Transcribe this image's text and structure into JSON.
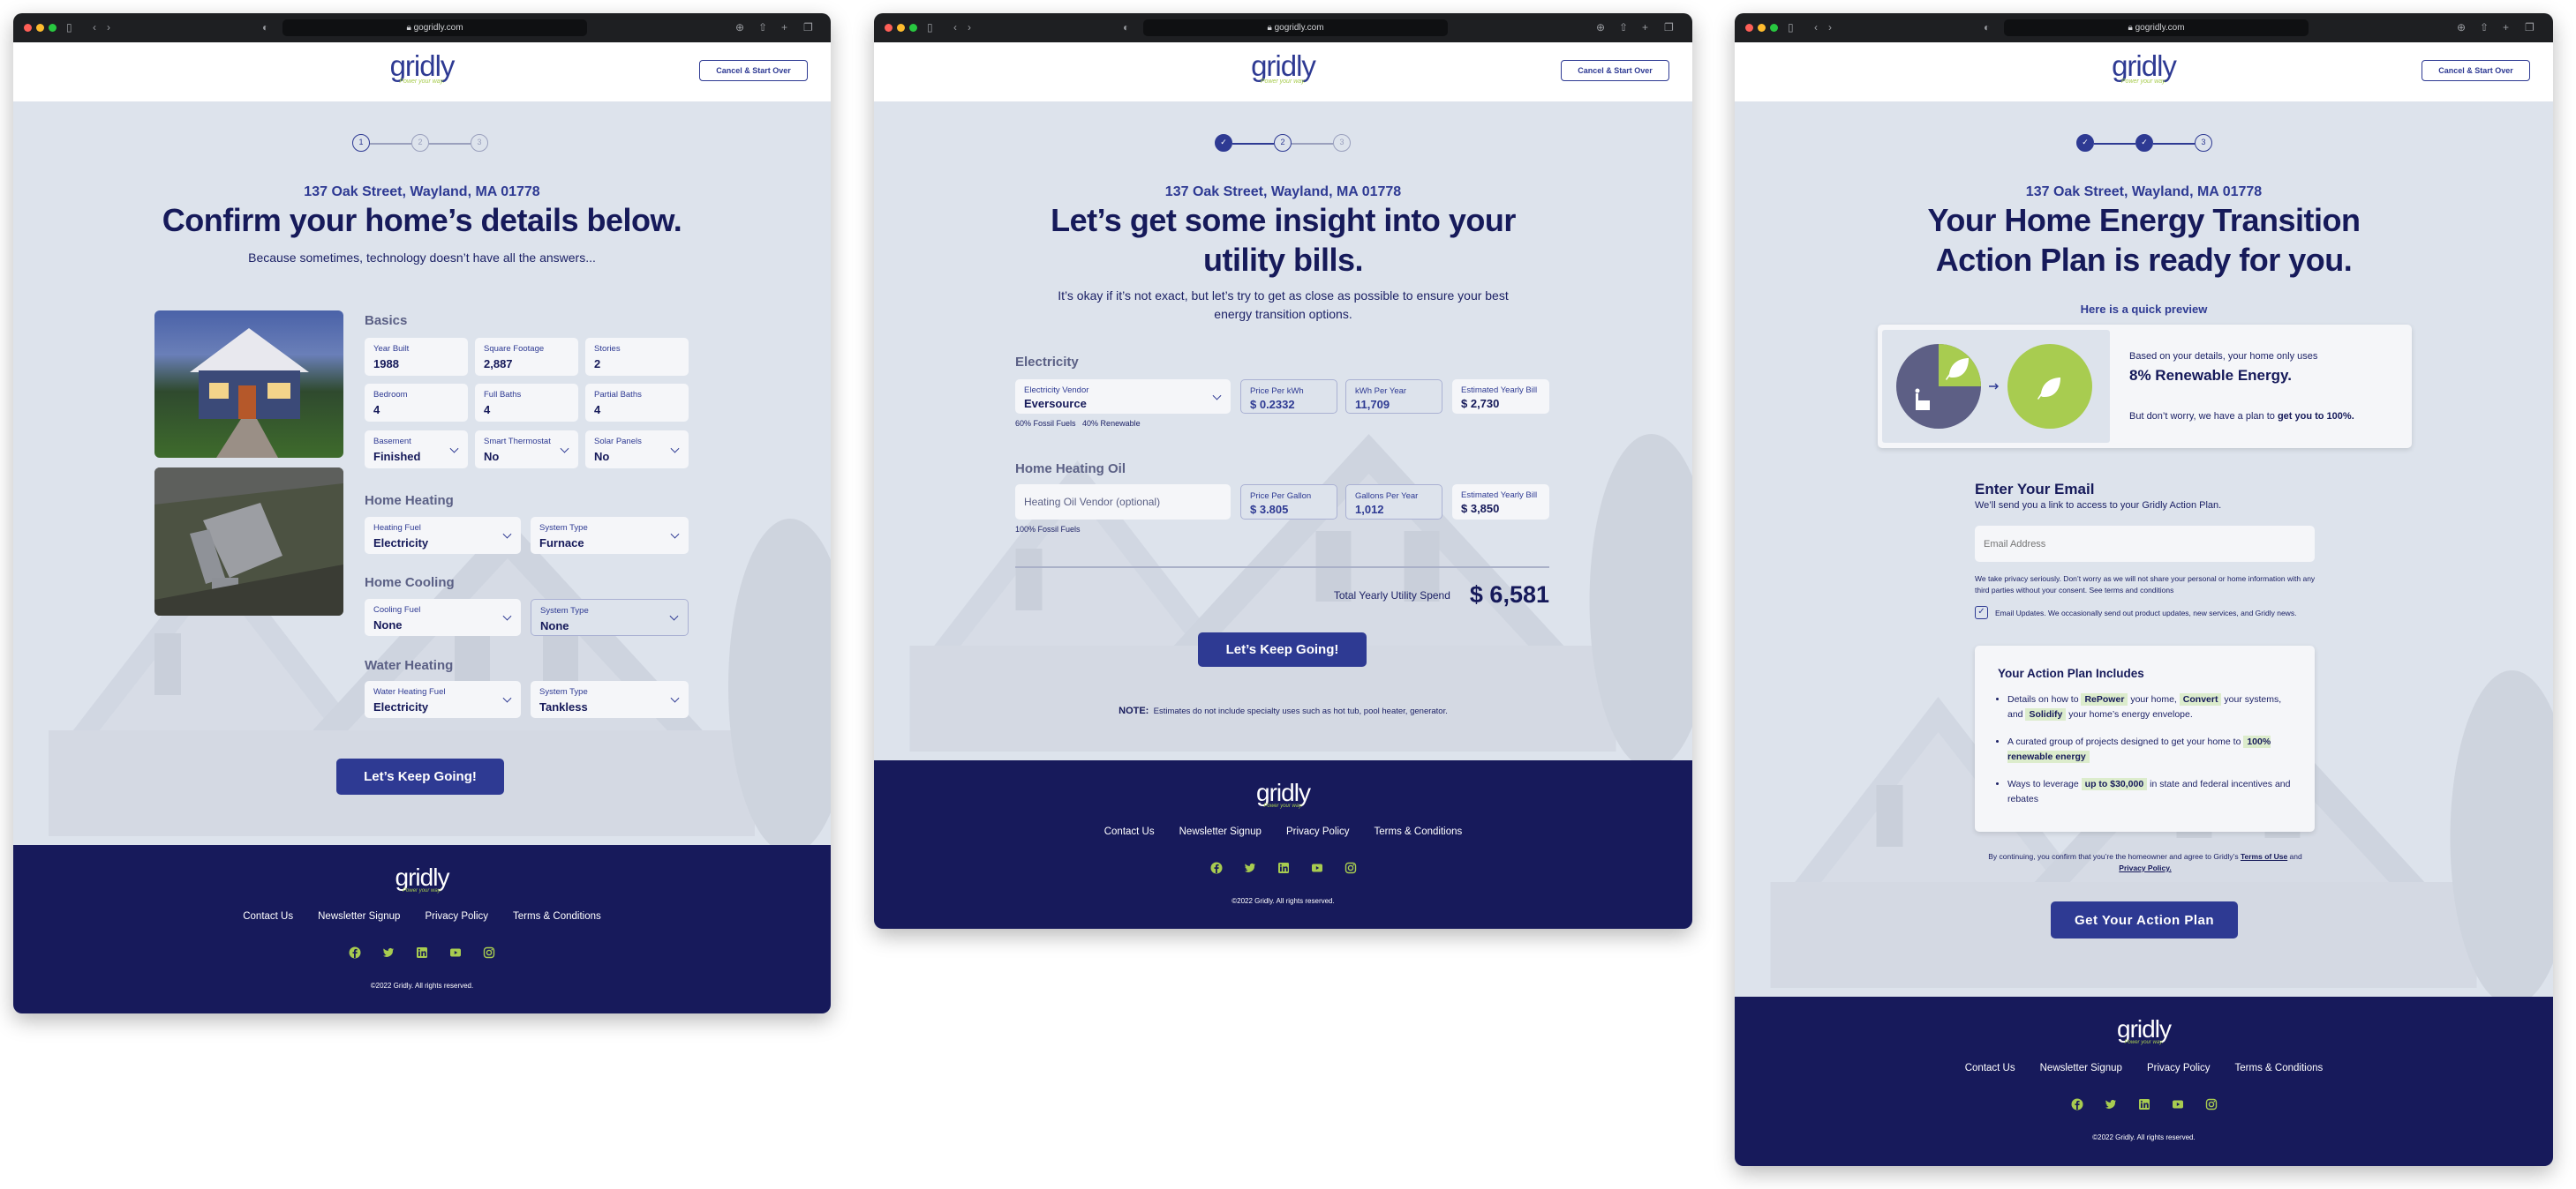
{
  "browser": {
    "url": "gogridly.com"
  },
  "brand": {
    "logo": "gridly",
    "tagline": "Power your way."
  },
  "header": {
    "cancel_label": "Cancel & Start Over"
  },
  "address": "137 Oak Street, Wayland, MA 01778",
  "colors": {
    "navy": "#161a5a",
    "primary": "#2e3a93",
    "accent_green": "#a8cc50",
    "background": "#dde3ec",
    "footer": "#171a5b"
  },
  "footer": {
    "links": [
      "Contact Us",
      "Newsletter Signup",
      "Privacy Policy",
      "Terms & Conditions"
    ],
    "social": [
      "facebook-icon",
      "twitter-icon",
      "linkedin-icon",
      "youtube-icon",
      "instagram-icon"
    ],
    "copyright": "©2022 Gridly. All rights reserved."
  },
  "step1": {
    "steps": [
      "1",
      "2",
      "3"
    ],
    "title": "Confirm your home’s details below.",
    "subtitle": "Because sometimes, technology doesn’t have all the answers...",
    "basics": {
      "heading": "Basics",
      "fields": [
        {
          "label": "Year Built",
          "value": "1988"
        },
        {
          "label": "Square Footage",
          "value": "2,887"
        },
        {
          "label": "Stories",
          "value": "2"
        },
        {
          "label": "Bedroom",
          "value": "4"
        },
        {
          "label": "Full Baths",
          "value": "4"
        },
        {
          "label": "Partial Baths",
          "value": "4"
        },
        {
          "label": "Basement",
          "value": "Finished"
        },
        {
          "label": "Smart Thermostat",
          "value": "No"
        },
        {
          "label": "Solar Panels",
          "value": "No"
        }
      ]
    },
    "heating": {
      "heading": "Home Heating",
      "fuel": {
        "label": "Heating Fuel",
        "value": "Electricity"
      },
      "system": {
        "label": "System Type",
        "value": "Furnace"
      }
    },
    "cooling": {
      "heading": "Home Cooling",
      "fuel": {
        "label": "Cooling Fuel",
        "value": "None"
      },
      "system": {
        "label": "System Type",
        "value": "None"
      }
    },
    "water": {
      "heading": "Water Heating",
      "fuel": {
        "label": "Water Heating Fuel",
        "value": "Electricity"
      },
      "system": {
        "label": "System Type",
        "value": "Tankless"
      }
    },
    "button": "Let’s Keep Going!"
  },
  "step2": {
    "steps": [
      "2",
      "3"
    ],
    "title_line1": "Let’s get some insight into your",
    "title_line2": "utility bills.",
    "subtitle_line1": "It’s okay if it’s not exact, but let’s try to get as close as possible to ensure your best",
    "subtitle_line2": "energy transition options.",
    "electricity": {
      "heading": "Electricity",
      "vendor": {
        "label": "Electricity Vendor",
        "value": "Eversource"
      },
      "price": {
        "label": "Price Per kWh",
        "value": "$ 0.2332"
      },
      "usage": {
        "label": "kWh Per Year",
        "value": "11,709"
      },
      "bill": {
        "label": "Estimated Yearly Bill",
        "value": "$ 2,730"
      },
      "mix_fossil": "60% Fossil Fuels",
      "mix_renewable": "40% Renewable"
    },
    "oil": {
      "heading": "Home Heating Oil",
      "vendor_placeholder": "Heating Oil Vendor (optional)",
      "price": {
        "label": "Price Per Gallon",
        "value": "$ 3.805"
      },
      "usage": {
        "label": "Gallons Per Year",
        "value": "1,012"
      },
      "bill": {
        "label": "Estimated Yearly Bill",
        "value": "$ 3,850"
      },
      "mix_fossil": "100% Fossil Fuels"
    },
    "total_label": "Total Yearly Utility Spend",
    "total_value": "$ 6,581",
    "button": "Let’s Keep Going!",
    "note_label": "NOTE:",
    "note_text": "Estimates do not include specialty uses such as hot tub, pool heater, generator."
  },
  "step3": {
    "steps": [
      "3"
    ],
    "title_line1": "Your Home Energy Transition",
    "title_line2": "Action Plan is ready for you.",
    "preview_label": "Here is a quick preview",
    "preview": {
      "intro": "Based on your details, your home only uses",
      "headline": "8% Renewable Energy.",
      "outro_prefix": "But don’t worry, we have a plan to ",
      "outro_bold": "get you to 100%."
    },
    "email": {
      "heading": "Enter Your Email",
      "sub": "We’ll send you a link to access to your Gridly Action Plan.",
      "placeholder": "Email Address",
      "privacy": "We take privacy seriously. Don’t worry as we will not share your personal or home information with any third parties without your consent. See terms and conditions",
      "updates_checked": true,
      "updates_label": "Email Updates. We occasionally send out product updates, new services, and Gridly news."
    },
    "plan": {
      "heading": "Your Action Plan Includes",
      "b1": [
        "Details on how to ",
        "RePower",
        " your home, ",
        "Convert",
        " your systems, and ",
        "Solidify",
        " your home’s energy envelope."
      ],
      "b2": [
        "A curated group of projects designed to get your home to ",
        "100% renewable energy"
      ],
      "b3": [
        "Ways to leverage ",
        "up to $30,000",
        " in state and federal incentives and rebates"
      ]
    },
    "consent": [
      "By continuing, you confirm that you’re the homeowner and agree to Gridly’s ",
      "Terms of Use",
      " and ",
      "Privacy Policy."
    ],
    "button": "Get Your Action Plan"
  }
}
